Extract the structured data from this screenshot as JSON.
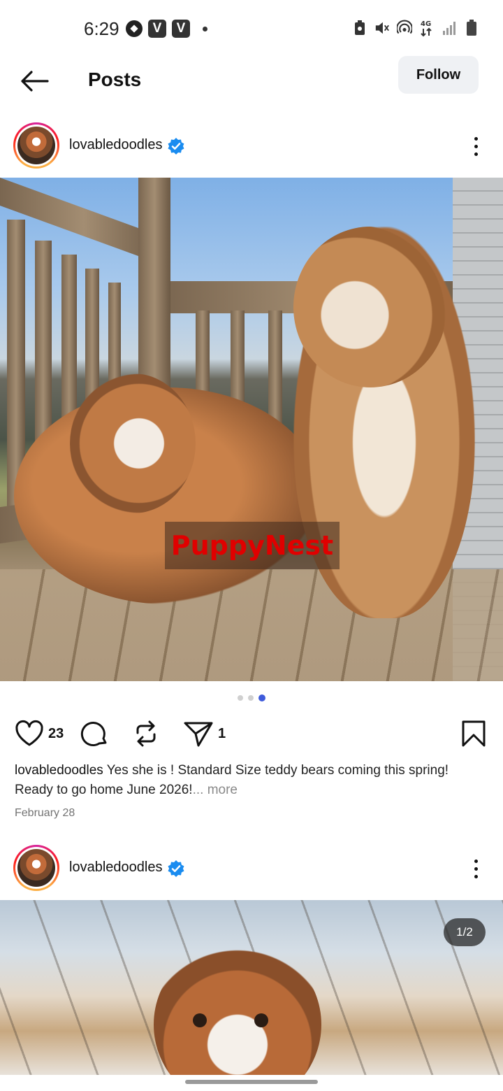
{
  "status_bar": {
    "time": "6:29",
    "left_icons": [
      "soccer-ball-icon",
      "v-app-icon",
      "v-app-icon",
      "notification-dot"
    ],
    "v_label": "V",
    "network_label": "4G",
    "right_icons": [
      "battery-saver-icon",
      "mute-icon",
      "hotspot-icon",
      "network-4g-icon",
      "signal-icon",
      "battery-icon"
    ]
  },
  "header": {
    "title": "Posts",
    "follow_label": "Follow"
  },
  "posts": [
    {
      "username": "lovabledoodles",
      "verified": true,
      "watermark": "PuppyNest",
      "carousel_total": 3,
      "carousel_active": 3,
      "likes": "23",
      "shares": "1",
      "caption_user": "lovabledoodles",
      "caption_text": " Yes she is ! Standard Size teddy bears coming this spring! Ready to go home June 2026!",
      "caption_more": "... more",
      "date": "February 28"
    },
    {
      "username": "lovabledoodles",
      "verified": true,
      "page_counter": "1/2"
    }
  ],
  "colors": {
    "verified": "#1a8cf0",
    "follow_bg": "#eff1f4",
    "dot_active": "#3f5bdb",
    "watermark_text": "#e00000"
  }
}
